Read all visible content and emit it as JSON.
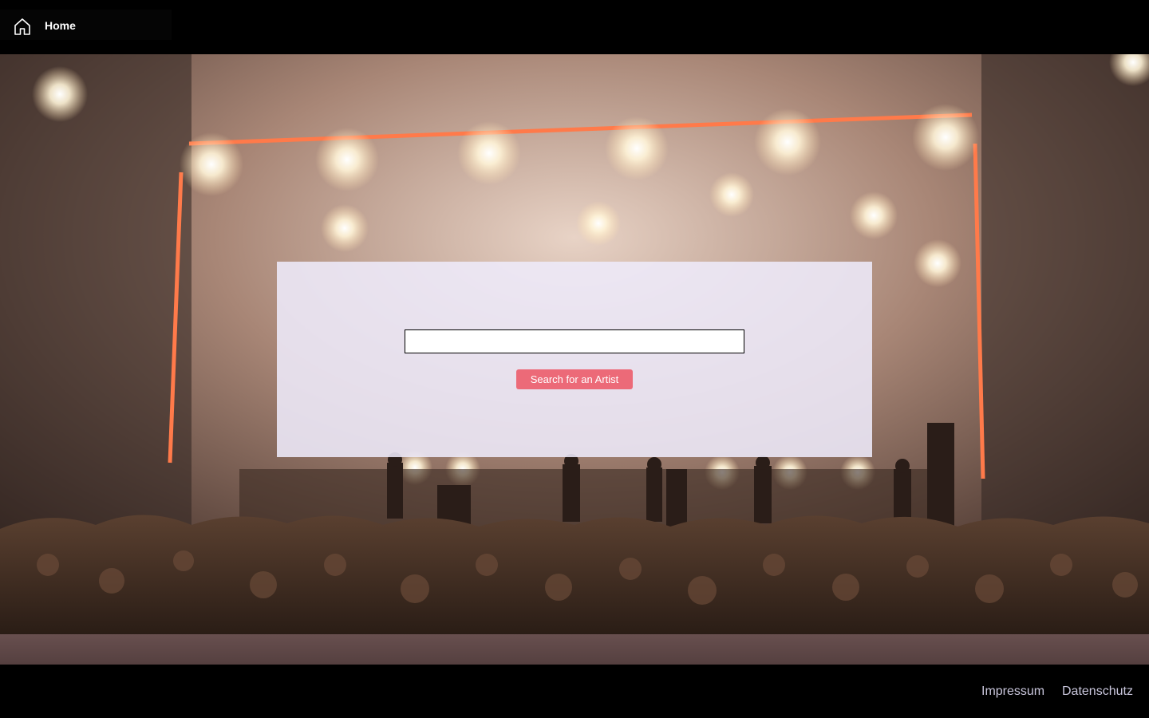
{
  "header": {
    "home_label": "Home",
    "home_icon": "home-icon"
  },
  "hero": {
    "background": "concert-stage-photo",
    "search": {
      "input_value": "",
      "input_placeholder": "",
      "button_label": "Search for an Artist",
      "button_color": "#ec6a78"
    }
  },
  "footer": {
    "links": [
      {
        "label": "Impressum"
      },
      {
        "label": "Datenschutz"
      }
    ]
  }
}
